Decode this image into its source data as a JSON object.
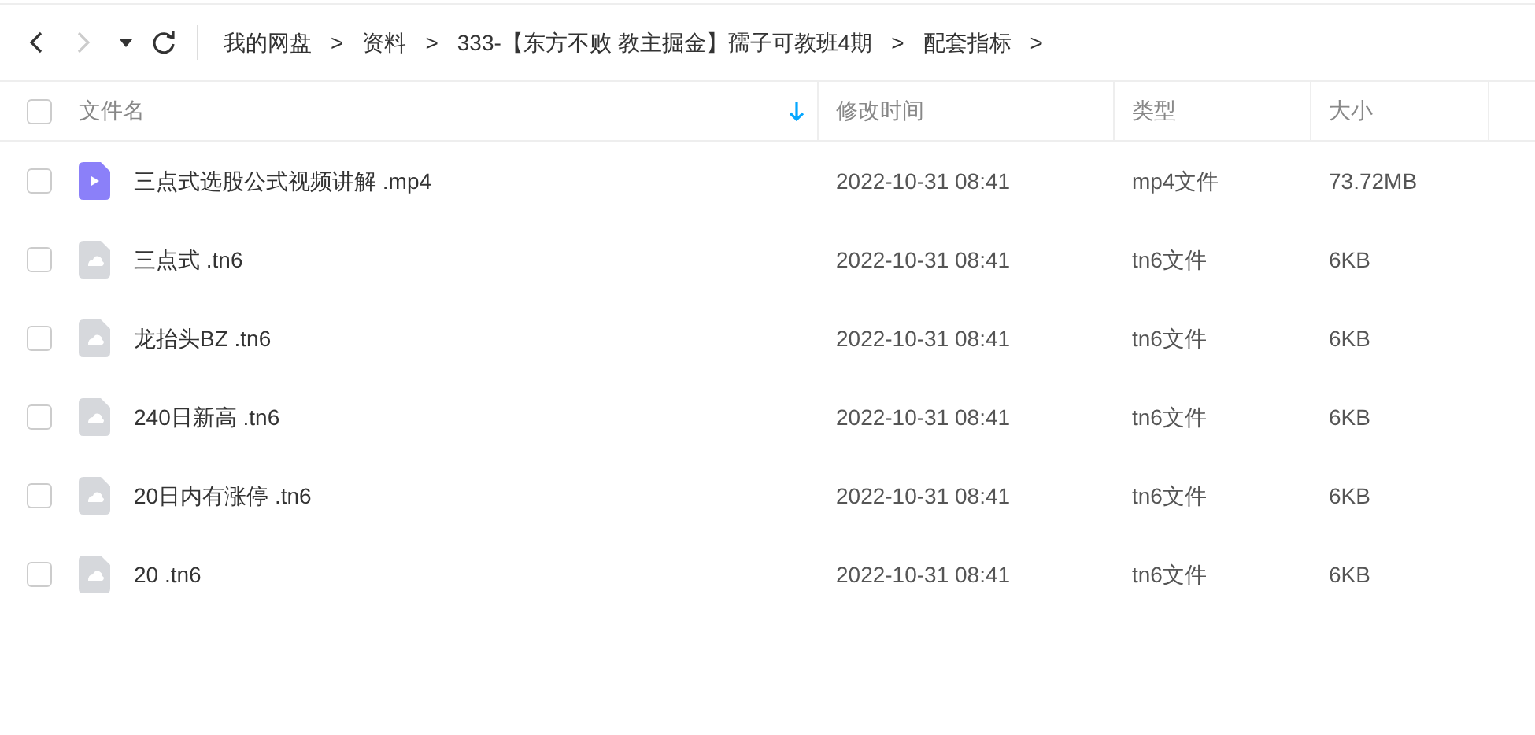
{
  "breadcrumb": [
    {
      "label": "我的网盘"
    },
    {
      "label": "资料"
    },
    {
      "label": "333-【东方不败 教主掘金】孺子可教班4期"
    },
    {
      "label": "配套指标"
    }
  ],
  "separator": ">",
  "nav": {
    "back_disabled": false,
    "forward_disabled": true
  },
  "columns": [
    {
      "label": "文件名",
      "sorted": true
    },
    {
      "label": "修改时间",
      "sorted": false
    },
    {
      "label": "类型",
      "sorted": false
    },
    {
      "label": "大小",
      "sorted": false
    }
  ],
  "header_checked": false,
  "rows": [
    {
      "kind": "video",
      "name": "三点式选股公式视频讲解 .mp4",
      "modified": "2022-10-31 08:41",
      "type": "mp4文件",
      "size": "73.72MB",
      "checked": false
    },
    {
      "kind": "file",
      "name": "三点式 .tn6",
      "modified": "2022-10-31 08:41",
      "type": "tn6文件",
      "size": "6KB",
      "checked": false
    },
    {
      "kind": "file",
      "name": "龙抬头BZ .tn6",
      "modified": "2022-10-31 08:41",
      "type": "tn6文件",
      "size": "6KB",
      "checked": false
    },
    {
      "kind": "file",
      "name": "240日新高 .tn6",
      "modified": "2022-10-31 08:41",
      "type": "tn6文件",
      "size": "6KB",
      "checked": false
    },
    {
      "kind": "file",
      "name": "20日内有涨停 .tn6",
      "modified": "2022-10-31 08:41",
      "type": "tn6文件",
      "size": "6KB",
      "checked": false
    },
    {
      "kind": "file",
      "name": "20 .tn6",
      "modified": "2022-10-31 08:41",
      "type": "tn6文件",
      "size": "6KB",
      "checked": false
    }
  ]
}
